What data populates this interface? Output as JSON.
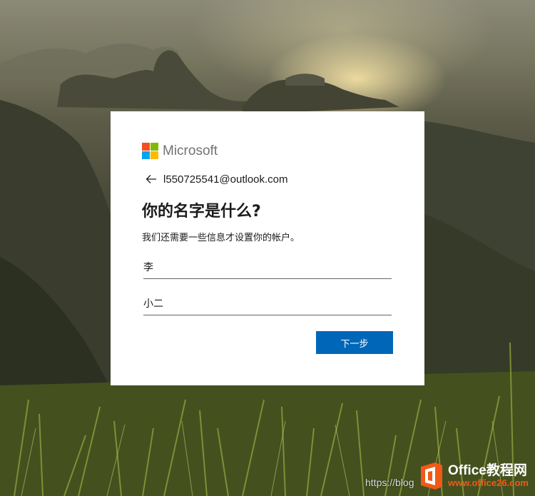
{
  "app": {
    "brand_name": "Microsoft",
    "brand_colors": [
      "#f25022",
      "#7fba00",
      "#00a4ef",
      "#ffb900"
    ]
  },
  "account": {
    "email": "l550725541@outlook.com"
  },
  "page": {
    "title": "你的名字是什么?",
    "subtitle": "我们还需要一些信息才设置你的帐户。"
  },
  "form": {
    "last_name_value": "李",
    "first_name_value": "小二",
    "next_label": "下一步"
  },
  "watermark": {
    "url_text": "https://blog",
    "brand": "Office教程网",
    "site": "www.office26.com",
    "brand_color": "#ef5a16"
  }
}
